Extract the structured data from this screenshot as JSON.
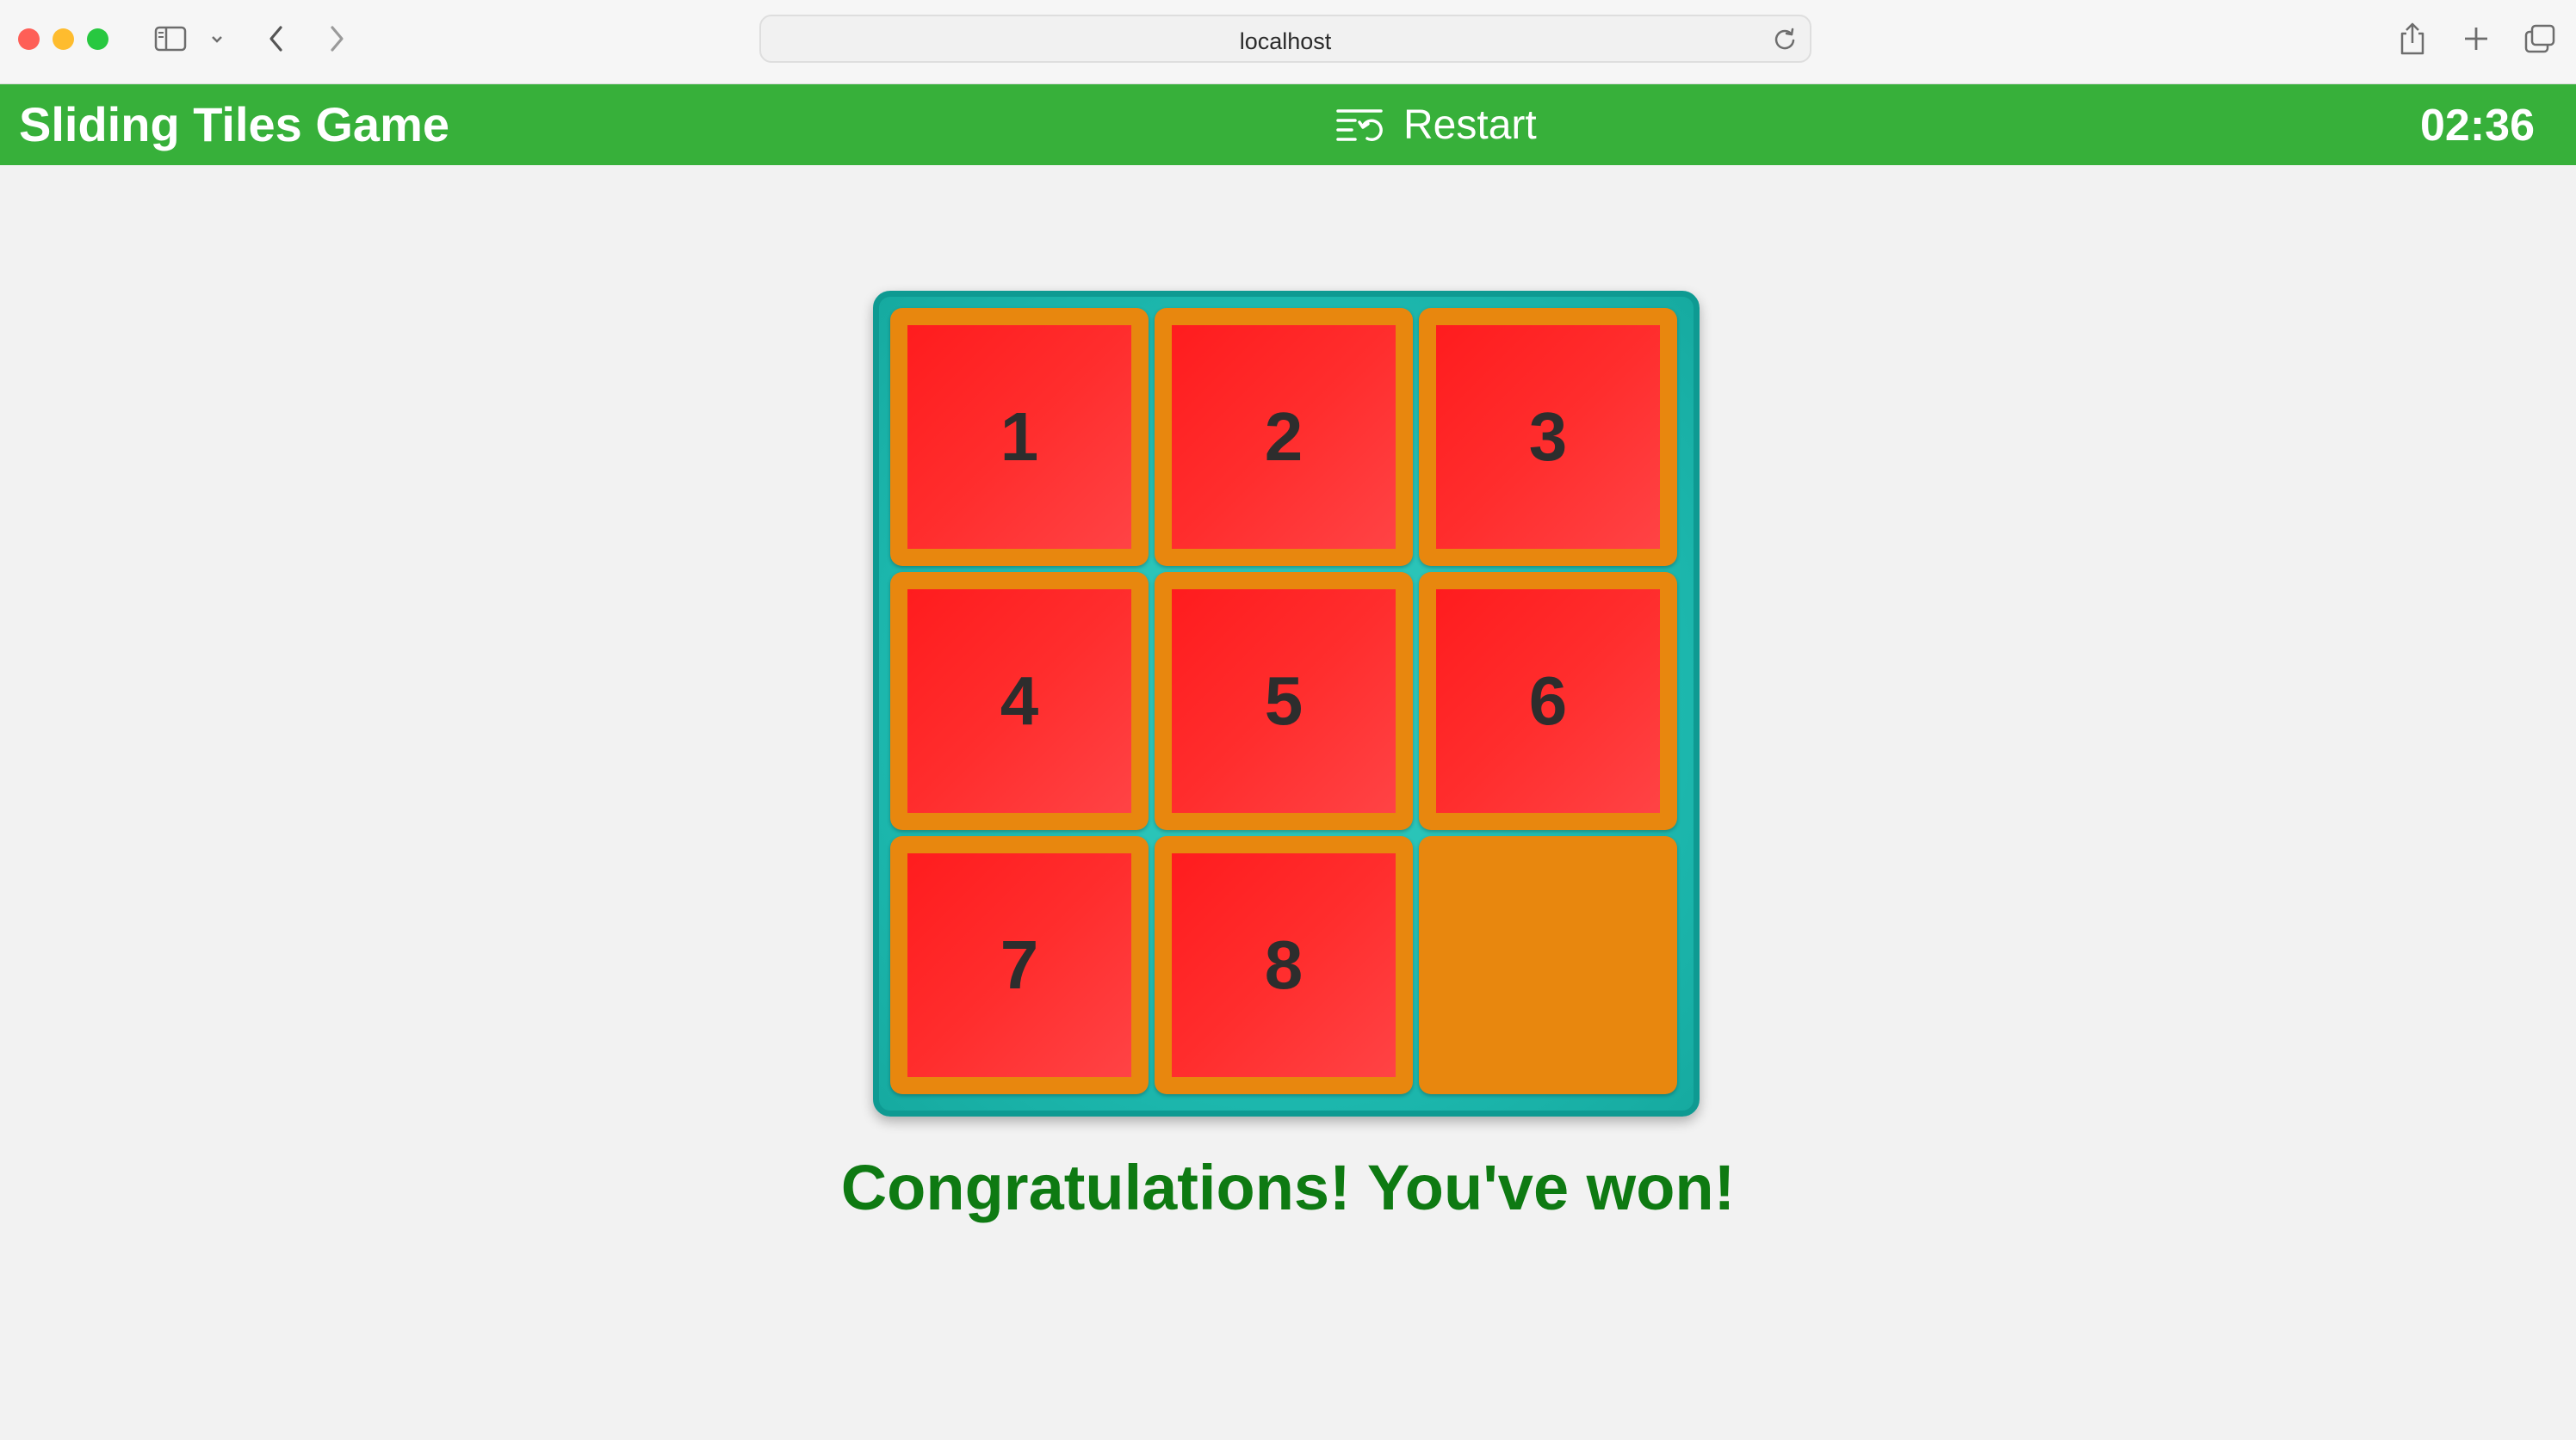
{
  "browser": {
    "url": "localhost"
  },
  "header": {
    "title": "Sliding Tiles Game",
    "restart_label": "Restart",
    "timer": "02:36"
  },
  "board": {
    "tiles": [
      "1",
      "2",
      "3",
      "4",
      "5",
      "6",
      "7",
      "8",
      ""
    ]
  },
  "message": "Congratulations! You've won!",
  "colors": {
    "header_bg": "#37b03a",
    "board_border": "#0e9a92",
    "tile_frame": "#e8870e",
    "tile_face": "#ff2d2d",
    "win_text": "#0e7a12"
  }
}
